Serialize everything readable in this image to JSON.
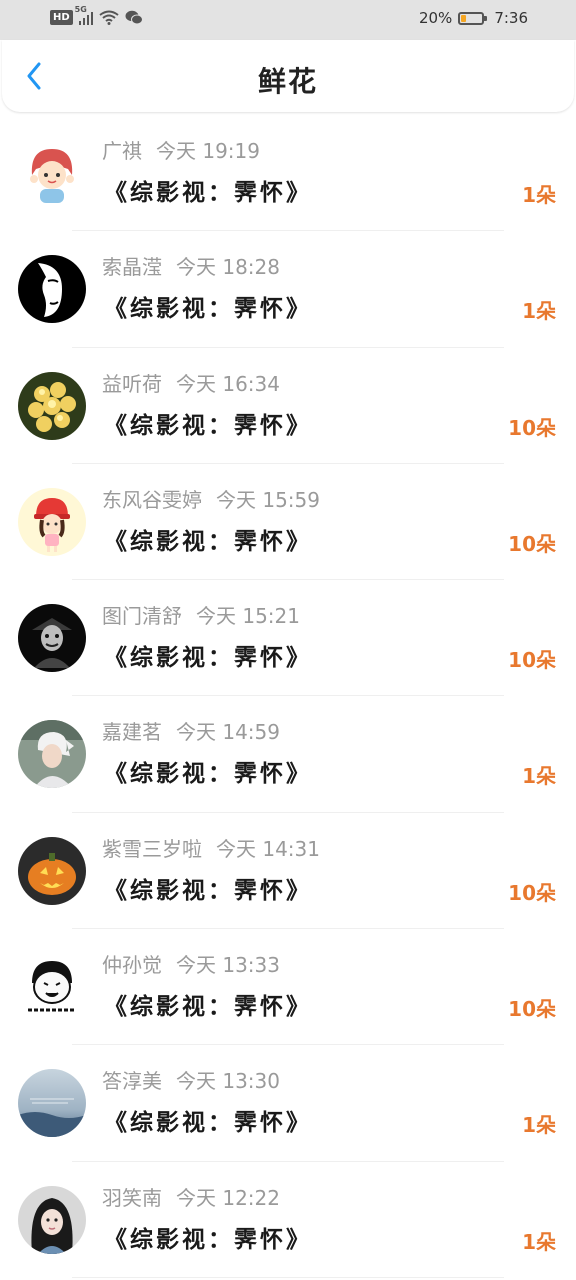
{
  "status_bar": {
    "badge": "HD",
    "network": "5G",
    "battery_percent": "20%",
    "battery_level": 0.2,
    "time": "7:36"
  },
  "header": {
    "title": "鲜花",
    "back_icon": "chevron-left-icon"
  },
  "colors": {
    "accent": "#2196f3",
    "count": "#e8782e"
  },
  "items": [
    {
      "name": "广祺",
      "time": "今天 19:19",
      "book": "《综影视：霁怀》",
      "count": "1朵",
      "avatar": "cartoon-girl"
    },
    {
      "name": "索晶滢",
      "time": "今天 18:28",
      "book": "《综影视：霁怀》",
      "count": "1朵",
      "avatar": "mask-face"
    },
    {
      "name": "益听荷",
      "time": "今天 16:34",
      "book": "《综影视：霁怀》",
      "count": "10朵",
      "avatar": "yellow-flower"
    },
    {
      "name": "东风谷雯婷",
      "time": "今天 15:59",
      "book": "《综影视：霁怀》",
      "count": "10朵",
      "avatar": "cartoon-red-hat"
    },
    {
      "name": "图门清舒",
      "time": "今天 15:21",
      "book": "《综影视：霁怀》",
      "count": "10朵",
      "avatar": "dark-portrait"
    },
    {
      "name": "嘉建茗",
      "time": "今天 14:59",
      "book": "《综影视：霁怀》",
      "count": "1朵",
      "avatar": "white-hair-person"
    },
    {
      "name": "紫雪三岁啦",
      "time": "今天 14:31",
      "book": "《综影视：霁怀》",
      "count": "10朵",
      "avatar": "pumpkin"
    },
    {
      "name": "仲孙觉",
      "time": "今天 13:33",
      "book": "《综影视：霁怀》",
      "count": "10朵",
      "avatar": "meme-face"
    },
    {
      "name": "答淳美",
      "time": "今天 13:30",
      "book": "《综影视：霁怀》",
      "count": "1朵",
      "avatar": "sea-sky"
    },
    {
      "name": "羽笑南",
      "time": "今天 12:22",
      "book": "《综影视：霁怀》",
      "count": "1朵",
      "avatar": "girl-photo"
    }
  ]
}
